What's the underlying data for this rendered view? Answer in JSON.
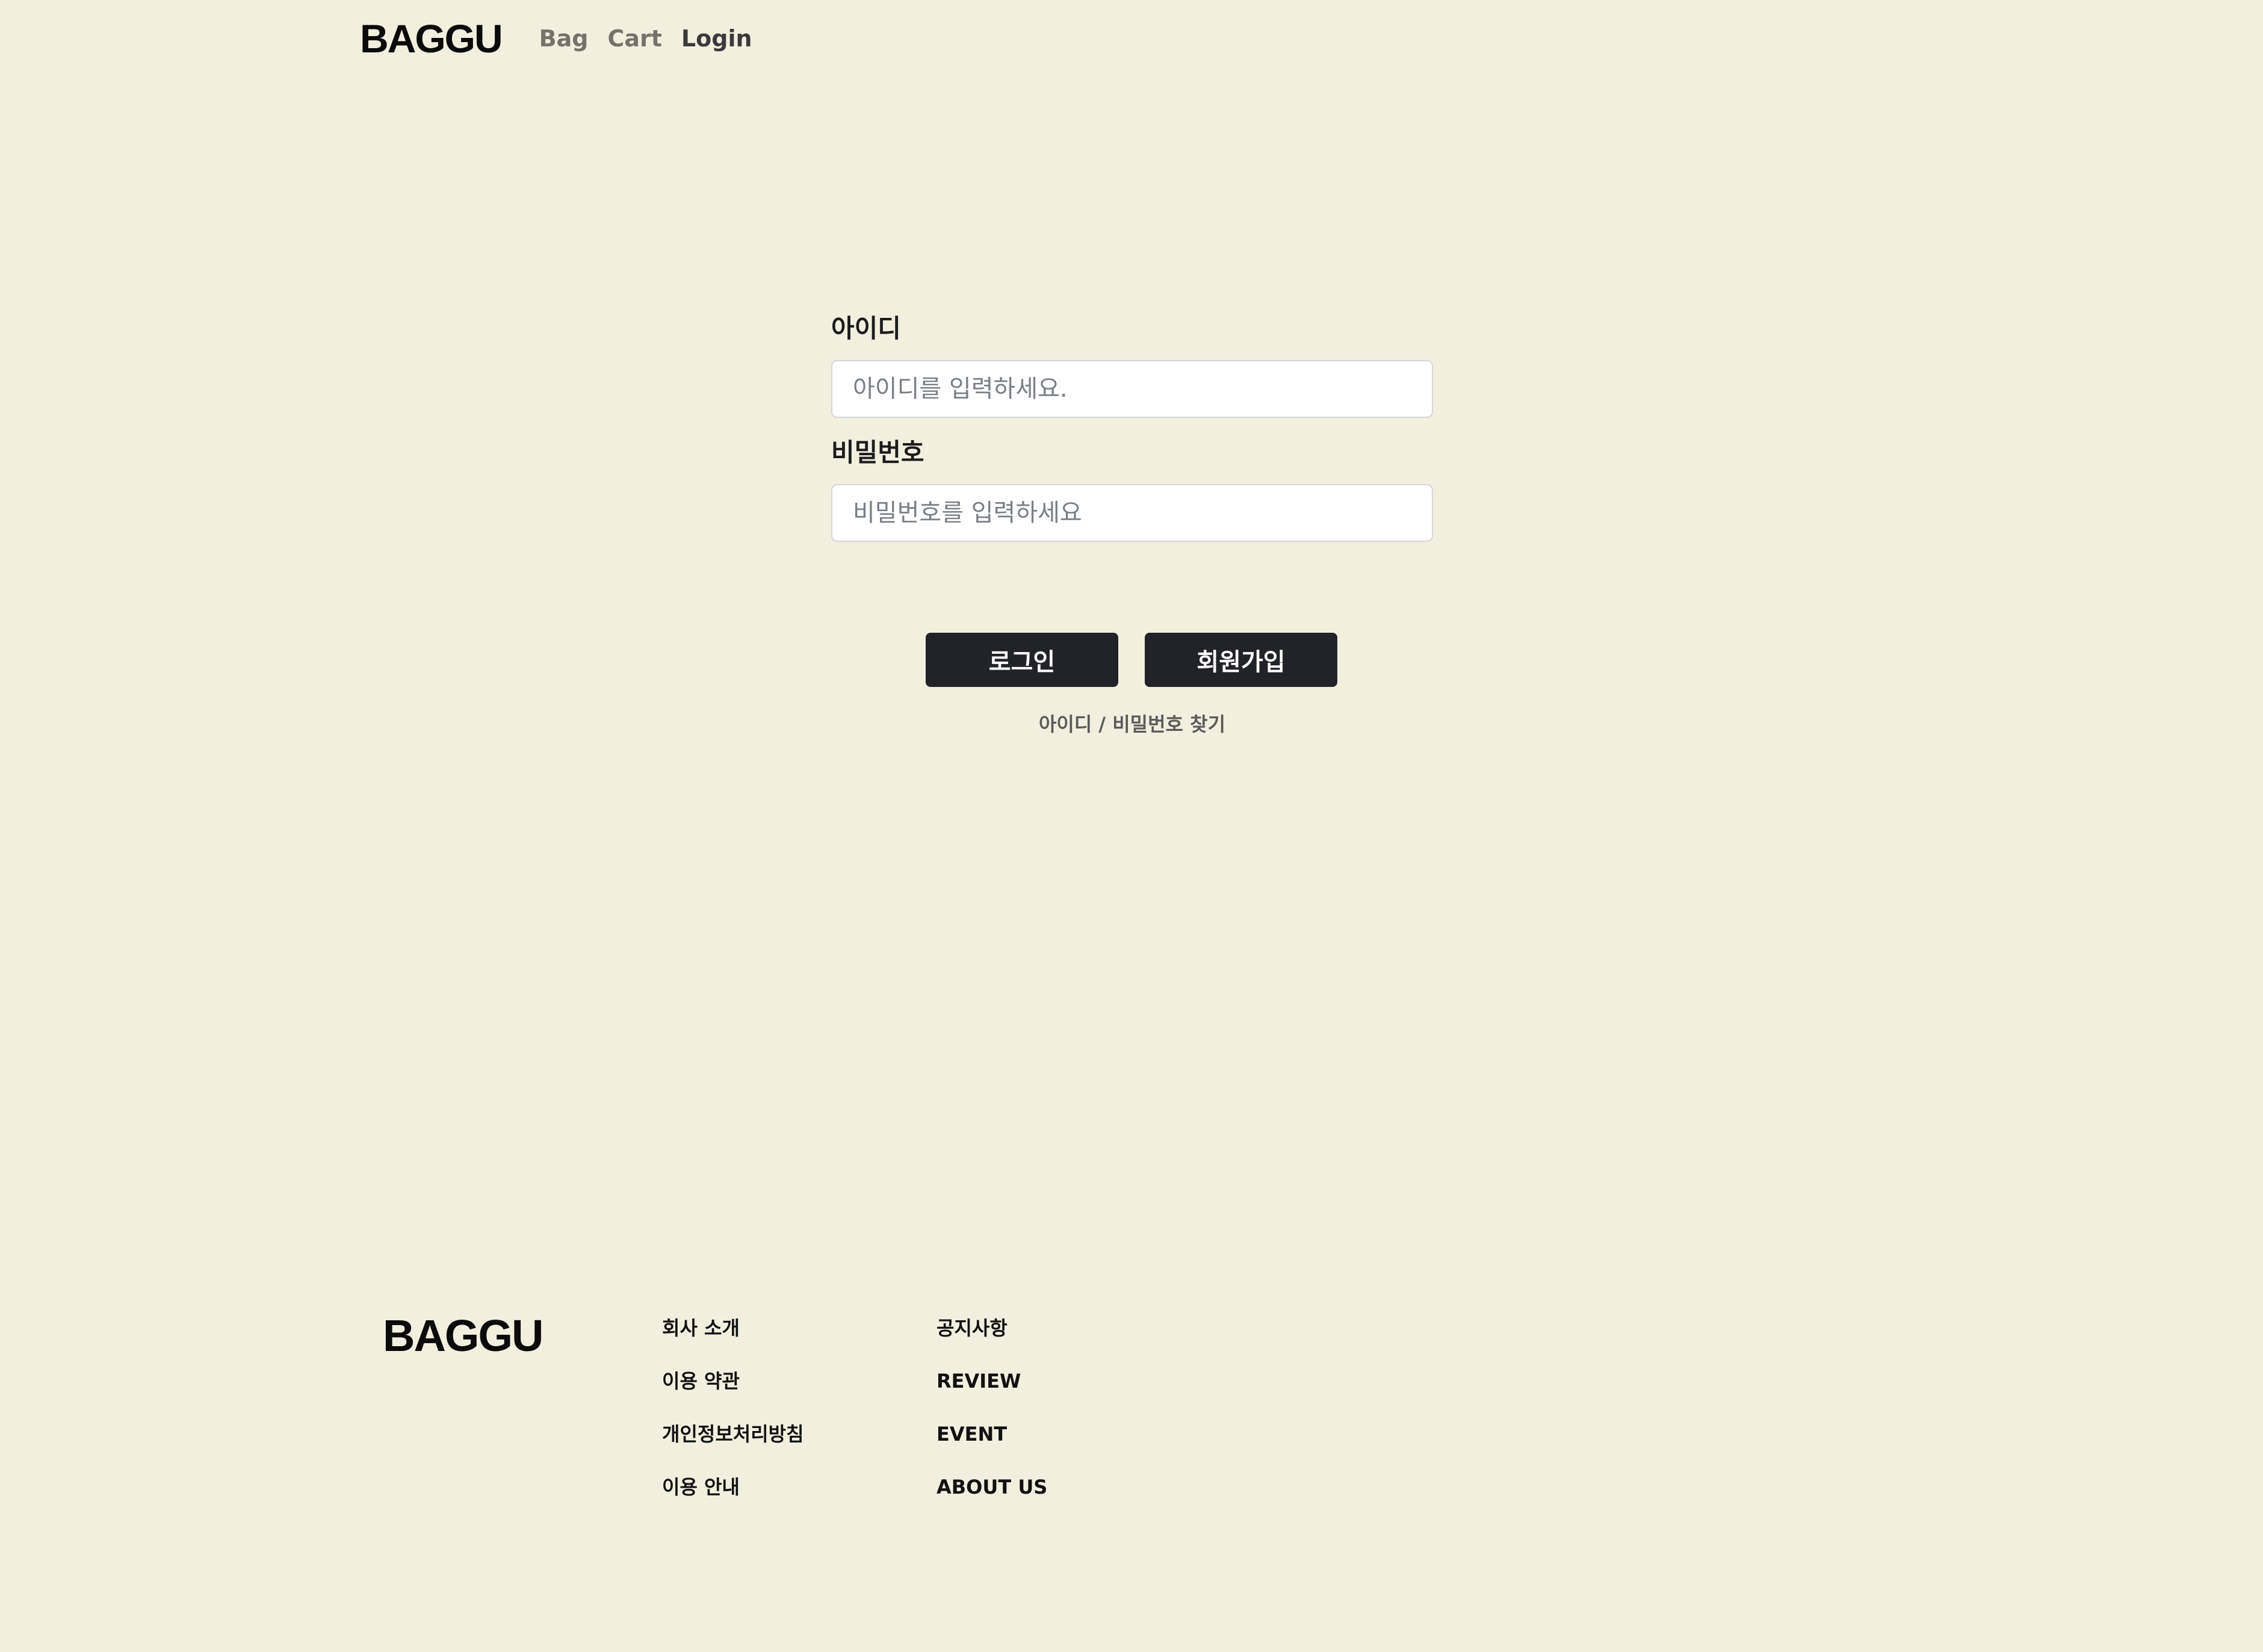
{
  "header": {
    "brand": "BAGGU",
    "nav": [
      {
        "label": "Bag"
      },
      {
        "label": "Cart"
      },
      {
        "label": "Login"
      }
    ]
  },
  "login": {
    "id_label": "아이디",
    "id_placeholder": "아이디를 입력하세요.",
    "id_value": "",
    "password_label": "비밀번호",
    "password_placeholder": "비밀번호를 입력하세요",
    "password_value": "",
    "login_button": "로그인",
    "signup_button": "회원가입",
    "find_link": "아이디 / 비밀번호 찾기"
  },
  "footer": {
    "brand": "BAGGU",
    "col1": [
      {
        "label": "회사 소개"
      },
      {
        "label": "이용 약관"
      },
      {
        "label": "개인정보처리방침"
      },
      {
        "label": "이용 안내"
      }
    ],
    "col2": [
      {
        "label": "공지사항"
      },
      {
        "label": "REVIEW"
      },
      {
        "label": "EVENT"
      },
      {
        "label": "ABOUT US"
      }
    ]
  },
  "colors": {
    "background": "#f2efdf",
    "button": "#212328",
    "nav_inactive": "#76726a",
    "nav_active": "#3a3a3a"
  }
}
